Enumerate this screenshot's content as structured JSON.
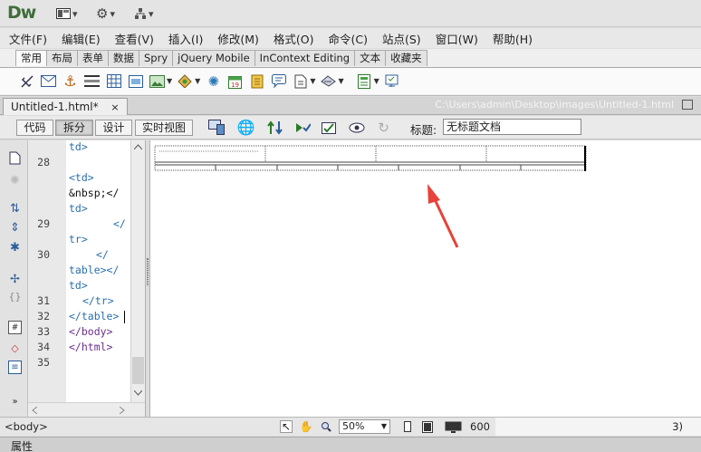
{
  "app": {
    "logo": "Dw"
  },
  "menu": [
    "文件(F)",
    "编辑(E)",
    "查看(V)",
    "插入(I)",
    "修改(M)",
    "格式(O)",
    "命令(C)",
    "站点(S)",
    "窗口(W)",
    "帮助(H)"
  ],
  "insert_tabs": [
    "常用",
    "布局",
    "表单",
    "数据",
    "Spry",
    "jQuery Mobile",
    "InContext Editing",
    "文本",
    "收藏夹"
  ],
  "document": {
    "tab_label": "Untitled-1.html*",
    "close_glyph": "×",
    "path": "C:\\Users\\admin\\Desktop\\images\\Untitled-1.html"
  },
  "view_buttons": [
    "代码",
    "拆分",
    "设计",
    "实时视图"
  ],
  "title_label": "标题:",
  "title_value": "无标题文档",
  "gutter_lines": [
    "28",
    "29",
    "30",
    "31",
    "32",
    "33",
    "34",
    "35"
  ],
  "code_lines": [
    "td>",
    "<td>",
    "&nbsp;</",
    "td>",
    "</",
    "tr>",
    "</",
    "table></",
    "td>",
    "</tr>",
    "</table>",
    "</body>",
    "</html>"
  ],
  "status": {
    "tag": "<body>",
    "zoom": "50%",
    "window_size": "600",
    "tail": "3)"
  },
  "properties_label": "属性",
  "colors": {
    "arrow": "#e8423a",
    "code_tag": "#2a6fad",
    "logo": "#3f6e3a"
  }
}
